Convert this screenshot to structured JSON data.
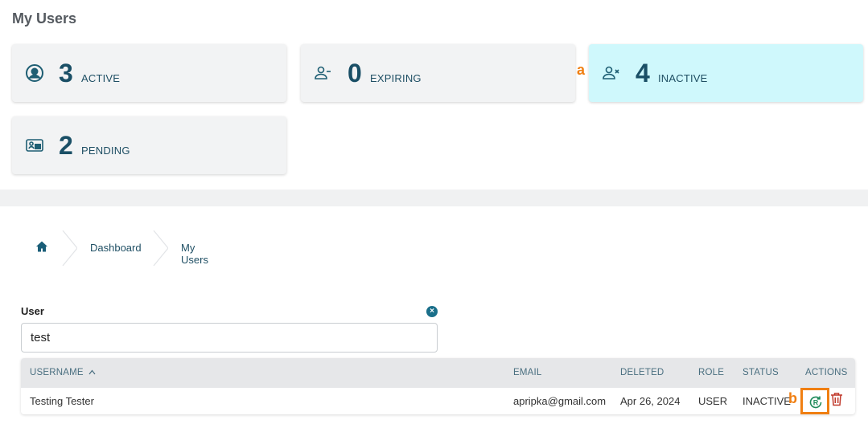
{
  "page": {
    "title": "My Users"
  },
  "stats": [
    {
      "count": "3",
      "label": "ACTIVE",
      "icon": "user-circle-icon"
    },
    {
      "count": "0",
      "label": "EXPIRING",
      "icon": "user-minus-icon"
    },
    {
      "count": "4",
      "label": "INACTIVE",
      "icon": "user-x-icon"
    },
    {
      "count": "2",
      "label": "PENDING",
      "icon": "id-card-icon"
    }
  ],
  "markers": {
    "a": "a",
    "b": "b"
  },
  "breadcrumb": {
    "items": [
      "Dashboard",
      "My Users"
    ]
  },
  "filter": {
    "label": "User",
    "value": "test",
    "clear_icon": "×"
  },
  "table": {
    "columns": [
      "USERNAME",
      "EMAIL",
      "DELETED",
      "ROLE",
      "STATUS",
      "ACTIONS"
    ],
    "sort_indicator": "^",
    "rows": [
      {
        "username": "Testing Tester",
        "email": "apripka@gmail.com",
        "deleted": "Apr 26, 2024",
        "role": "USER",
        "status": "INACTIVE"
      }
    ]
  },
  "colors": {
    "accent": "#1a4f66",
    "highlight_card": "#cff8fc",
    "marker": "#f07f12",
    "delete": "#c0392b",
    "restore": "#1e8a5a"
  }
}
